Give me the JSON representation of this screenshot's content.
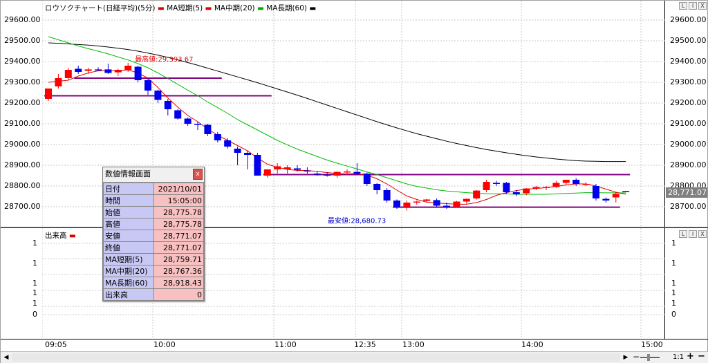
{
  "chart_title": "ロウソクチャート(日経平均)(5分)",
  "legend": [
    {
      "label": "MA短期(5)",
      "color": "#e00000"
    },
    {
      "label": "MA中期(20)",
      "color": "#e00000"
    },
    {
      "label": "MA長期(60)",
      "color": "#00aa00"
    },
    {
      "label": "",
      "color": "#000000"
    }
  ],
  "volume_title": "出来高",
  "price_ticks": [
    "29600.00",
    "29500.00",
    "29400.00",
    "29300.00",
    "29200.00",
    "29100.00",
    "29000.00",
    "28900.00",
    "28800.00",
    "28700.00"
  ],
  "volume_ticks": [
    "1",
    "1",
    "1",
    "1",
    "1",
    "0"
  ],
  "time_labels": [
    "09:05",
    "10:00",
    "11:00",
    "12:35",
    "13:00",
    "14:00",
    "15:00"
  ],
  "current_price": "28,771.07",
  "annotations": {
    "high": "最高値:29,393.67",
    "low": "最安値:28,680.73"
  },
  "window_buttons": [
    "L",
    "I",
    "X"
  ],
  "info_panel": {
    "title": "数値情報画面",
    "close_label": "x",
    "rows": [
      {
        "key": "日付",
        "value": "2021/10/01"
      },
      {
        "key": "時間",
        "value": "15:05:00"
      },
      {
        "key": "始値",
        "value": "28,775.78"
      },
      {
        "key": "高値",
        "value": "28,775.78"
      },
      {
        "key": "安値",
        "value": "28,771.07"
      },
      {
        "key": "終値",
        "value": "28,771.07"
      },
      {
        "key": "MA短期(5)",
        "value": "28,759.71"
      },
      {
        "key": "MA中期(20)",
        "value": "28,767.36"
      },
      {
        "key": "MA長期(60)",
        "value": "28,918.43"
      },
      {
        "key": "出来高",
        "value": "0"
      }
    ]
  },
  "scrollbar": {
    "ratio": "1:1",
    "plus": "+",
    "minus": "−"
  },
  "chart_data": {
    "type": "candlestick",
    "ylim": [
      28630,
      29640
    ],
    "candles": [
      {
        "o": 29220,
        "h": 29250,
        "l": 29210,
        "c": 29270
      },
      {
        "o": 29280,
        "h": 29340,
        "l": 29270,
        "c": 29320
      },
      {
        "o": 29320,
        "h": 29370,
        "l": 29310,
        "c": 29360
      },
      {
        "o": 29365,
        "h": 29380,
        "l": 29340,
        "c": 29350
      },
      {
        "o": 29355,
        "h": 29370,
        "l": 29340,
        "c": 29362
      },
      {
        "o": 29362,
        "h": 29372,
        "l": 29355,
        "c": 29360
      },
      {
        "o": 29362,
        "h": 29390,
        "l": 29340,
        "c": 29345
      },
      {
        "o": 29348,
        "h": 29365,
        "l": 29330,
        "c": 29360
      },
      {
        "o": 29360,
        "h": 29394,
        "l": 29350,
        "c": 29380
      },
      {
        "o": 29375,
        "h": 29380,
        "l": 29300,
        "c": 29310
      },
      {
        "o": 29310,
        "h": 29320,
        "l": 29240,
        "c": 29260
      },
      {
        "o": 29260,
        "h": 29265,
        "l": 29200,
        "c": 29215
      },
      {
        "o": 29210,
        "h": 29220,
        "l": 29140,
        "c": 29170
      },
      {
        "o": 29165,
        "h": 29170,
        "l": 29120,
        "c": 29125
      },
      {
        "o": 29125,
        "h": 29130,
        "l": 29090,
        "c": 29100
      },
      {
        "o": 29100,
        "h": 29110,
        "l": 29070,
        "c": 29098
      },
      {
        "o": 29095,
        "h": 29100,
        "l": 29040,
        "c": 29050
      },
      {
        "o": 29050,
        "h": 29060,
        "l": 29010,
        "c": 29020
      },
      {
        "o": 29020,
        "h": 29030,
        "l": 28980,
        "c": 28990
      },
      {
        "o": 28980,
        "h": 28990,
        "l": 28900,
        "c": 28960
      },
      {
        "o": 28960,
        "h": 28970,
        "l": 28880,
        "c": 28950
      },
      {
        "o": 28950,
        "h": 28960,
        "l": 28850,
        "c": 28850
      },
      {
        "o": 28850,
        "h": 28880,
        "l": 28840,
        "c": 28880
      },
      {
        "o": 28880,
        "h": 28910,
        "l": 28860,
        "c": 28895
      },
      {
        "o": 28880,
        "h": 28900,
        "l": 28860,
        "c": 28890
      },
      {
        "o": 28885,
        "h": 28900,
        "l": 28870,
        "c": 28878
      },
      {
        "o": 28875,
        "h": 28890,
        "l": 28860,
        "c": 28870
      },
      {
        "o": 28860,
        "h": 28870,
        "l": 28850,
        "c": 28858
      },
      {
        "o": 28855,
        "h": 28865,
        "l": 28845,
        "c": 28850
      },
      {
        "o": 28850,
        "h": 28870,
        "l": 28840,
        "c": 28868
      },
      {
        "o": 28865,
        "h": 28880,
        "l": 28855,
        "c": 28870
      },
      {
        "o": 28868,
        "h": 28910,
        "l": 28855,
        "c": 28860
      },
      {
        "o": 28860,
        "h": 28865,
        "l": 28800,
        "c": 28810
      },
      {
        "o": 28810,
        "h": 28815,
        "l": 28760,
        "c": 28780
      },
      {
        "o": 28780,
        "h": 28790,
        "l": 28720,
        "c": 28730
      },
      {
        "o": 28730,
        "h": 28735,
        "l": 28690,
        "c": 28700
      },
      {
        "o": 28700,
        "h": 28730,
        "l": 28681,
        "c": 28720
      },
      {
        "o": 28722,
        "h": 28730,
        "l": 28710,
        "c": 28725
      },
      {
        "o": 28728,
        "h": 28738,
        "l": 28720,
        "c": 28735
      },
      {
        "o": 28732,
        "h": 28740,
        "l": 28700,
        "c": 28705
      },
      {
        "o": 28705,
        "h": 28720,
        "l": 28690,
        "c": 28700
      },
      {
        "o": 28700,
        "h": 28728,
        "l": 28695,
        "c": 28725
      },
      {
        "o": 28725,
        "h": 28740,
        "l": 28715,
        "c": 28738
      },
      {
        "o": 28740,
        "h": 28780,
        "l": 28735,
        "c": 28778
      },
      {
        "o": 28780,
        "h": 28830,
        "l": 28770,
        "c": 28820
      },
      {
        "o": 28815,
        "h": 28825,
        "l": 28800,
        "c": 28810
      },
      {
        "o": 28815,
        "h": 28820,
        "l": 28760,
        "c": 28770
      },
      {
        "o": 28770,
        "h": 28780,
        "l": 28750,
        "c": 28760
      },
      {
        "o": 28765,
        "h": 28790,
        "l": 28755,
        "c": 28788
      },
      {
        "o": 28788,
        "h": 28800,
        "l": 28780,
        "c": 28795
      },
      {
        "o": 28795,
        "h": 28800,
        "l": 28780,
        "c": 28795
      },
      {
        "o": 28795,
        "h": 28825,
        "l": 28790,
        "c": 28815
      },
      {
        "o": 28815,
        "h": 28830,
        "l": 28805,
        "c": 28830
      },
      {
        "o": 28830,
        "h": 28838,
        "l": 28800,
        "c": 28810
      },
      {
        "o": 28808,
        "h": 28818,
        "l": 28800,
        "c": 28810
      },
      {
        "o": 28800,
        "h": 28810,
        "l": 28730,
        "c": 28740
      },
      {
        "o": 28738,
        "h": 28745,
        "l": 28720,
        "c": 28730
      },
      {
        "o": 28745,
        "h": 28770,
        "l": 28720,
        "c": 28762
      },
      {
        "o": 28776,
        "h": 28776,
        "l": 28771,
        "c": 28771
      }
    ],
    "ma_short": [
      29300,
      29305,
      29310,
      29330,
      29345,
      29355,
      29355,
      29355,
      29360,
      29345,
      29320,
      29275,
      29225,
      29180,
      29140,
      29110,
      29075,
      29045,
      29020,
      28995,
      28970,
      28935,
      28905,
      28890,
      28880,
      28875,
      28875,
      28870,
      28865,
      28860,
      28858,
      28860,
      28852,
      28835,
      28810,
      28780,
      28752,
      28735,
      28722,
      28718,
      28715,
      28712,
      28712,
      28720,
      28735,
      28755,
      28768,
      28778,
      28785,
      28788,
      28792,
      28798,
      28805,
      28810,
      28810,
      28800,
      28785,
      28770,
      28760
    ],
    "ma_mid": [
      29520,
      29505,
      29490,
      29475,
      29462,
      29450,
      29437,
      29422,
      29408,
      29390,
      29370,
      29345,
      29318,
      29290,
      29262,
      29235,
      29205,
      29178,
      29150,
      29120,
      29095,
      29070,
      29045,
      29020,
      28998,
      28978,
      28960,
      28942,
      28925,
      28910,
      28896,
      28882,
      28868,
      28855,
      28840,
      28825,
      28810,
      28798,
      28790,
      28782,
      28776,
      28772,
      28768,
      28765,
      28763,
      28762,
      28762,
      28760,
      28760,
      28760,
      28760,
      28762,
      28764,
      28766,
      28768,
      28768,
      28767,
      28767,
      28767
    ],
    "ma_long": [
      29490,
      29488,
      29485,
      29482,
      29479,
      29475,
      29470,
      29464,
      29458,
      29450,
      29441,
      29431,
      29420,
      29408,
      29395,
      29382,
      29368,
      29354,
      29340,
      29326,
      29312,
      29298,
      29283,
      29268,
      29253,
      29238,
      29222,
      29206,
      29190,
      29174,
      29158,
      29142,
      29126,
      29110,
      29095,
      29080,
      29066,
      29052,
      29040,
      29028,
      29016,
      29005,
      28995,
      28985,
      28976,
      28968,
      28960,
      28953,
      28946,
      28940,
      28935,
      28930,
      28926,
      28922,
      28920,
      28919,
      28918,
      28918,
      28918
    ],
    "hlines": [
      {
        "y": 29320,
        "from": 3,
        "to": 17
      },
      {
        "y": 29235,
        "from": 0,
        "to": 22
      },
      {
        "y": 28855,
        "from": 22,
        "to": 58
      },
      {
        "y": 28698,
        "from": 35,
        "to": 57
      }
    ]
  }
}
